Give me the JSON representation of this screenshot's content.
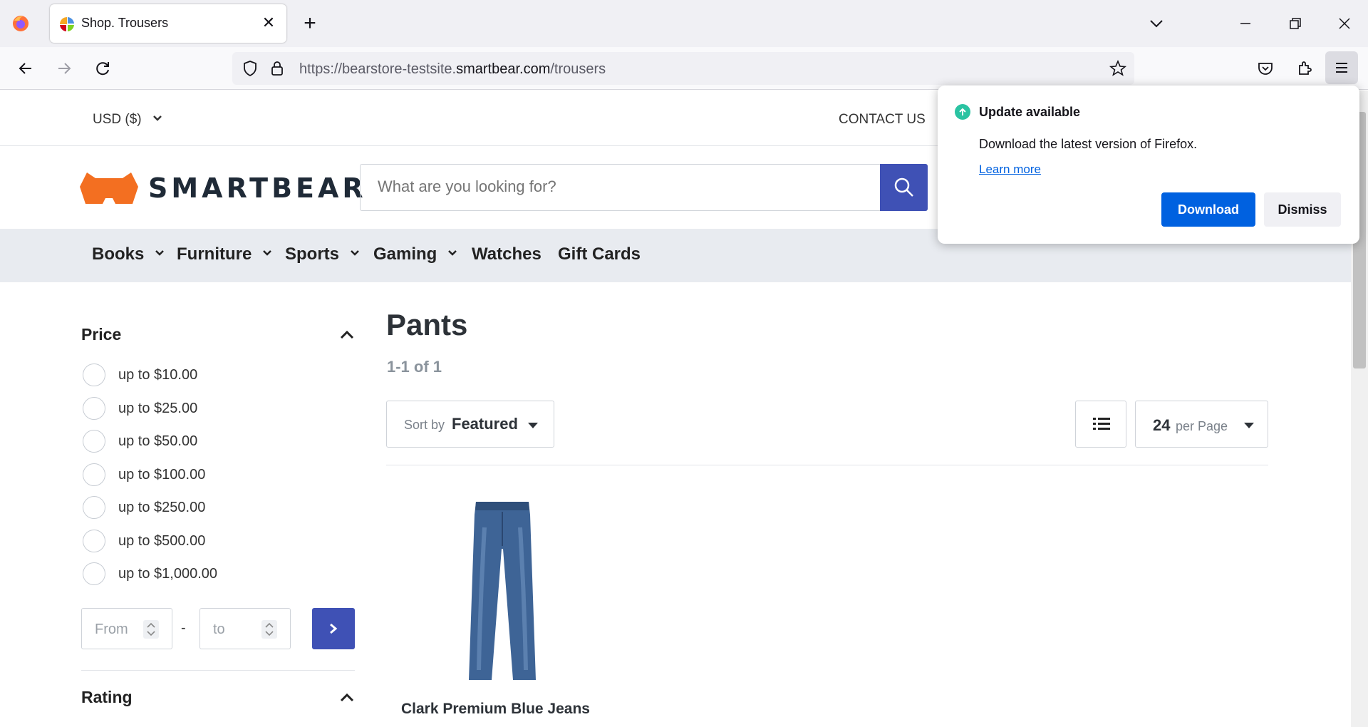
{
  "browser": {
    "tab_title": "Shop. Trousers",
    "url_scheme": "https://bearstore-testsite.",
    "url_host": "smartbear.com",
    "url_path": "/trousers",
    "new_tab_symbol": "+",
    "tab_close_symbol": "✕"
  },
  "site": {
    "currency": "USD ($)",
    "contact": "CONTACT US",
    "brand": "SMARTBEAR",
    "brand_color": "#f36f21",
    "accent": "#3f51b5",
    "search_placeholder": "What are you looking for?",
    "categories": [
      {
        "label": "Books",
        "dropdown": true
      },
      {
        "label": "Furniture",
        "dropdown": true
      },
      {
        "label": "Sports",
        "dropdown": true
      },
      {
        "label": "Gaming",
        "dropdown": true
      },
      {
        "label": "Watches",
        "dropdown": false
      },
      {
        "label": "Gift Cards",
        "dropdown": false
      }
    ]
  },
  "filters": {
    "price_title": "Price",
    "price_options": [
      "up to $10.00",
      "up to $25.00",
      "up to $50.00",
      "up to $100.00",
      "up to $250.00",
      "up to $500.00",
      "up to $1,000.00"
    ],
    "from_placeholder": "From",
    "to_placeholder": "to",
    "range_dash": "-",
    "rating_title": "Rating"
  },
  "listing": {
    "title": "Pants",
    "count": "1-1 of 1",
    "sort_label": "Sort by",
    "sort_value": "Featured",
    "per_page_value": "24",
    "per_page_label": "per Page",
    "products": [
      {
        "name": "Clark Premium Blue Jeans"
      }
    ]
  },
  "update_panel": {
    "title": "Update available",
    "description": "Download the latest version of Firefox.",
    "link": "Learn more",
    "download": "Download",
    "dismiss": "Dismiss"
  }
}
